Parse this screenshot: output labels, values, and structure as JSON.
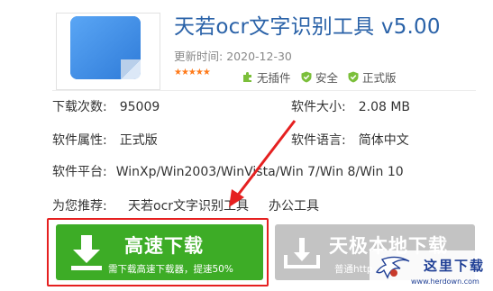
{
  "header": {
    "title": "天若ocr文字识别工具 v5.00",
    "date_label": "更新时间:",
    "date_value": "2020-12-30",
    "stars": "★★★★★",
    "tags": [
      "无插件",
      "安全",
      "正式版"
    ]
  },
  "info": {
    "downloads_label": "下载次数:",
    "downloads_value": "95009",
    "size_label": "软件大小:",
    "size_value": "2.08 MB",
    "property_label": "软件属性:",
    "property_value": "正式版",
    "language_label": "软件语言:",
    "language_value": "简体中文",
    "platform_label": "软件平台:",
    "platform_value": "WinXp/Win2003/WinVista/Win 7/Win 8/Win 10"
  },
  "recommend": {
    "label": "为您推荐:",
    "links": [
      "天若ocr文字识别工具",
      "办公工具"
    ]
  },
  "buttons": {
    "fast_label": "高速下载",
    "fast_sub": "需下载高速下载器，提速50%",
    "local_label": "天极本地下载",
    "local_sub": "普通http"
  },
  "watermark": {
    "text": "这里下载",
    "url": "www.herdown.com"
  },
  "colors": {
    "title": "#2a62a8",
    "fast_button": "#3dac26",
    "local_button": "#c3c3c3",
    "highlight": "#e52020",
    "stars": "#ff7a1a",
    "tag_check": "#7bbf3a"
  }
}
